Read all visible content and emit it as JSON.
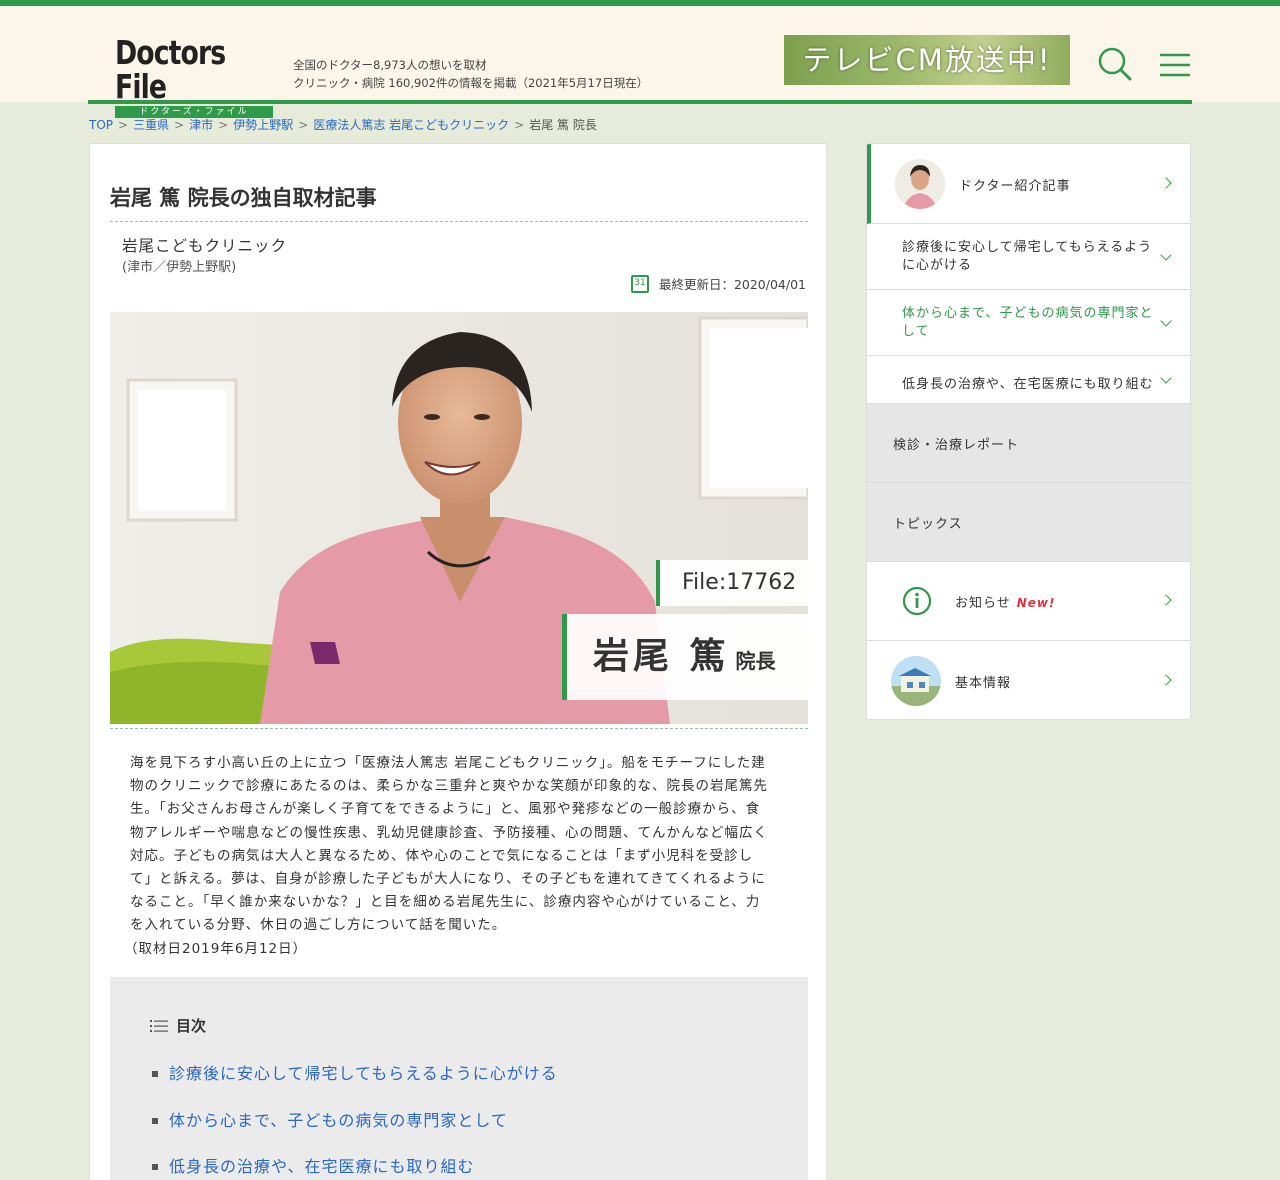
{
  "header": {
    "logo_title": "Doctors File",
    "logo_sub": "ドクターズ・ファイル",
    "tagline_line1": "全国のドクター8,973人の想いを取材",
    "tagline_line2": "クリニック・病院 160,902件の情報を掲載（2021年5月17日現在）",
    "cm_banner": "テレビCM放送中!",
    "accent_color": "#2e9a4a"
  },
  "breadcrumb": {
    "items": [
      "TOP",
      "三重県",
      "津市",
      "伊勢上野駅",
      "医療法人篤志 岩尾こどもクリニック"
    ],
    "current": "岩尾 篤 院長",
    "separator": ">"
  },
  "article": {
    "title": "岩尾 篤 院長の独自取材記事",
    "clinic_name": "岩尾こどもクリニック",
    "clinic_location": "(津市／伊勢上野駅)",
    "calendar_day": "31",
    "updated": "最終更新日：2020/04/01",
    "file_no": "File:17762",
    "doctor_name": "岩尾 篤",
    "doctor_role": "院長",
    "body_lines": [
      "海を見下ろす小高い丘の上に立つ「医療法人篤志 岩尾こどもクリニック」。船をモチーフにした建",
      "物のクリニックで診療にあたるのは、柔らかな三重弁と爽やかな笑顔が印象的な、院長の岩尾篤先",
      "生。「お父さんお母さんが楽しく子育てをできるように」と、風邪や発疹などの一般診療から、食",
      "物アレルギーや喘息などの慢性疾患、乳幼児健康診査、予防接種、心の問題、てんかんなど幅広く",
      "対応。子どもの病気は大人と異なるため、体や心のことで気になることは「まず小児科を受診し",
      "て」と訴える。夢は、自身が診療した子どもが大人になり、その子どもを連れてきてくれるように",
      "なること。「早く誰か来ないかな？」と目を細める岩尾先生に、診療内容や心がけていること、力",
      "を入れている分野、休日の過ごし方について話を聞いた。"
    ],
    "interview_date": "（取材日2019年6月12日）"
  },
  "toc": {
    "title": "目次",
    "items": [
      "診療後に安心して帰宅してもらえるように心がける",
      "体から心まで、子どもの病気の専門家として",
      "低身長の治療や、在宅医療にも取り組む"
    ]
  },
  "sidebar": {
    "intro": "ドクター紹介記事",
    "sections": [
      {
        "line1": "診療後に安心して帰宅してもらえるよう",
        "line2": "に心がける"
      },
      {
        "line1": "体から心まで、子どもの病気の専門家と",
        "line2": "して"
      },
      {
        "line1": "低身長の治療や、在宅医療にも取り組む",
        "line2": ""
      }
    ],
    "report": "検診・治療レポート",
    "topics": "トピックス",
    "news": "お知らせ",
    "news_badge": "New!",
    "basic": "基本情報"
  }
}
